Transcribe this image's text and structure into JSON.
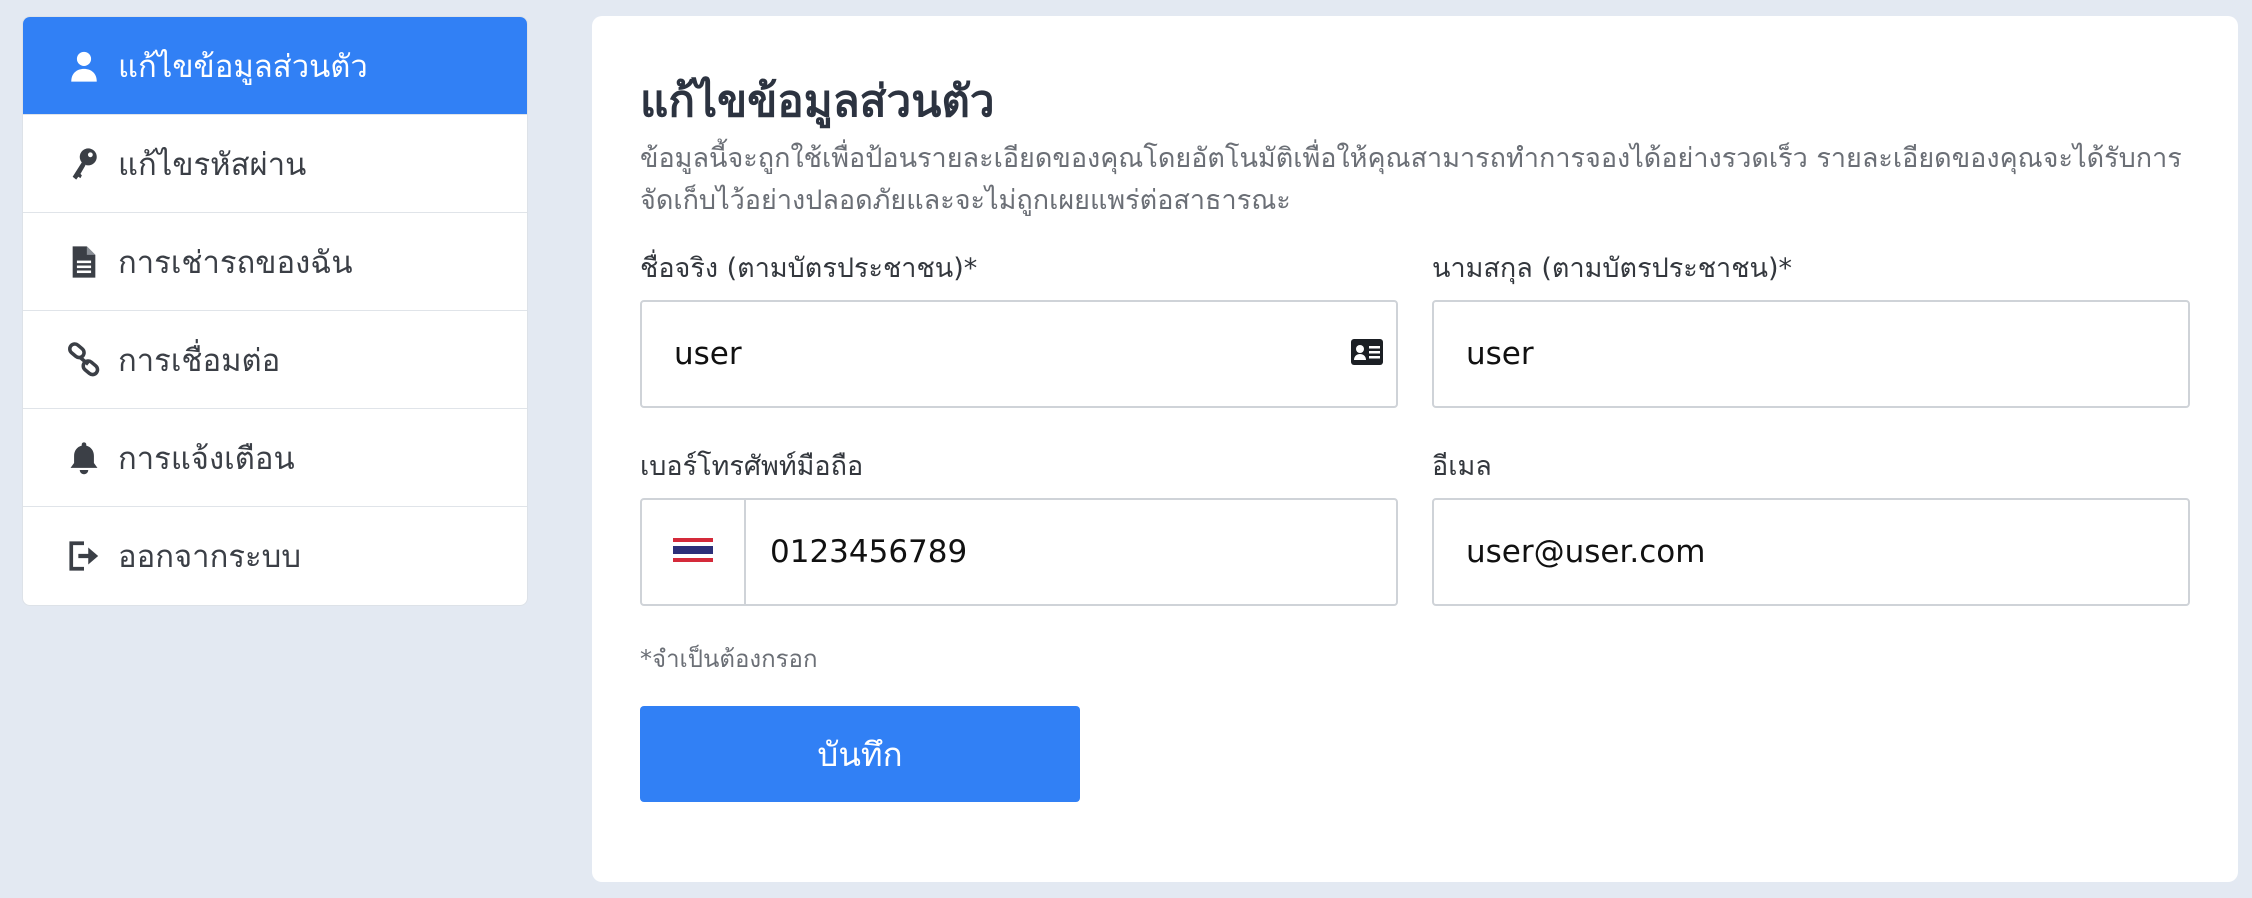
{
  "sidebar": {
    "items": [
      {
        "label": "แก้ไขข้อมูลส่วนตัว",
        "icon": "user-icon",
        "active": true
      },
      {
        "label": "แก้ไขรหัสผ่าน",
        "icon": "key-icon"
      },
      {
        "label": "การเช่ารถของฉัน",
        "icon": "document-icon"
      },
      {
        "label": "การเชื่อมต่อ",
        "icon": "link-icon"
      },
      {
        "label": "การแจ้งเตือน",
        "icon": "bell-icon"
      },
      {
        "label": "ออกจากระบบ",
        "icon": "logout-icon"
      }
    ]
  },
  "form": {
    "title": "แก้ไขข้อมูลส่วนตัว",
    "description": "ข้อมูลนี้จะถูกใช้เพื่อป้อนรายละเอียดของคุณโดยอัตโนมัติเพื่อให้คุณสามารถทำการจองได้อย่างรวดเร็ว รายละเอียดของคุณจะได้รับการจัดเก็บไว้อย่างปลอดภัยและจะไม่ถูกเผยแพร่ต่อสาธารณะ",
    "first_name": {
      "label": "ชื่อจริง (ตามบัตรประชาชน)*",
      "value": "user"
    },
    "last_name": {
      "label": "นามสกุล (ตามบัตรประชาชน)*",
      "value": "user"
    },
    "phone": {
      "label": "เบอร์โทรศัพท์มือถือ",
      "value": "0123456789",
      "country_flag": "thailand-flag-icon"
    },
    "email": {
      "label": "อีเมล",
      "value": "user@user.com"
    },
    "required_note": "*จำเป็นต้องกรอก",
    "save_label": "บันทึก"
  },
  "colors": {
    "accent": "#3180f5",
    "background": "#e3e9f2",
    "flag_red": "#d42a3a",
    "flag_blue": "#2d2f79"
  }
}
